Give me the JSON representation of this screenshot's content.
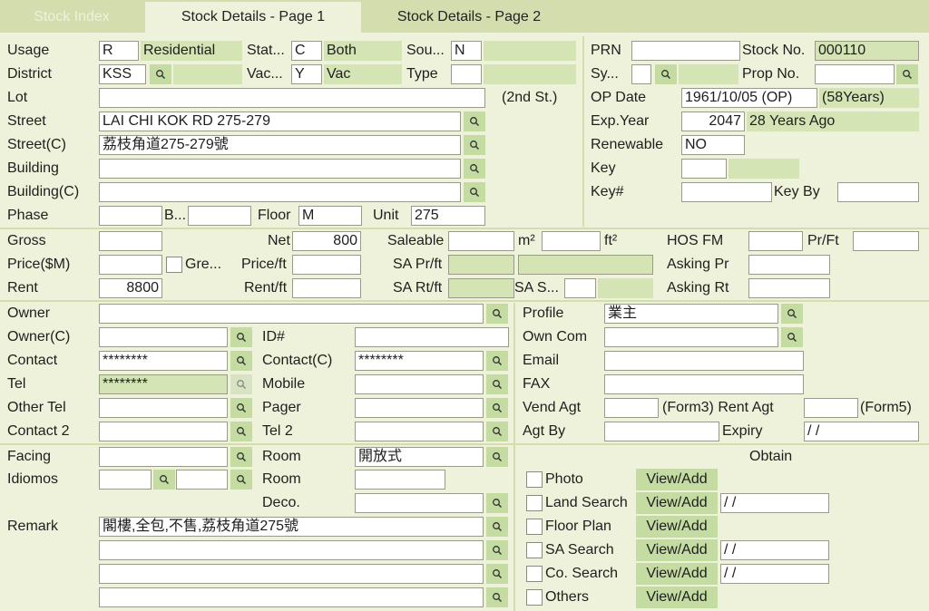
{
  "tabs": [
    "Stock Index",
    "Stock Details - Page 1",
    "Stock Details - Page 2"
  ],
  "labels": {
    "usage": "Usage",
    "district": "District",
    "lot": "Lot",
    "street": "Street",
    "street_c": "Street(C)",
    "building": "Building",
    "building_c": "Building(C)",
    "phase": "Phase",
    "block": "B...",
    "floor": "Floor",
    "unit": "Unit",
    "status": "Stat...",
    "vacant": "Vac...",
    "source": "Sou...",
    "type": "Type",
    "second_st": "(2nd St.)",
    "prn": "PRN",
    "stock_no": "Stock No.",
    "sy": "Sy...",
    "prop_no": "Prop No.",
    "op_date": "OP Date",
    "exp_year": "Exp.Year",
    "renewable": "Renewable",
    "key": "Key",
    "key_no": "Key#",
    "key_by": "Key By",
    "gross": "Gross",
    "net": "Net",
    "saleable": "Saleable",
    "m2": "m²",
    "ft2": "ft²",
    "hos_fm": "HOS FM",
    "pr_ft": "Pr/Ft",
    "price": "Price($M)",
    "gre": "Gre...",
    "price_ft": "Price/ft",
    "sa_pr_ft": "SA Pr/ft",
    "asking_pr": "Asking Pr",
    "rent": "Rent",
    "rent_ft": "Rent/ft",
    "sa_rt_ft": "SA Rt/ft",
    "sa_s": "SA S...",
    "asking_rt": "Asking Rt",
    "owner": "Owner",
    "owner_c": "Owner(C)",
    "id_no": "ID#",
    "contact": "Contact",
    "contact_c": "Contact(C)",
    "tel": "Tel",
    "mobile": "Mobile",
    "other_tel": "Other Tel",
    "pager": "Pager",
    "contact2": "Contact 2",
    "tel2": "Tel 2",
    "profile": "Profile",
    "own_com": "Own Com",
    "email": "Email",
    "fax": "FAX",
    "vend_agt": "Vend Agt",
    "form3_rent_agt": "(Form3) Rent Agt",
    "form5": "(Form5)",
    "agt_by": "Agt By",
    "expiry": "Expiry",
    "facing": "Facing",
    "idiomos": "Idiomos",
    "room": "Room",
    "room2": "Room",
    "deco": "Deco.",
    "remark": "Remark",
    "obtain": "Obtain"
  },
  "values": {
    "usage_code": "R",
    "usage_desc": "Residential",
    "status_code": "C",
    "status_desc": "Both",
    "source_code": "N",
    "district_code": "KSS",
    "vacant_code": "Y",
    "vacant_desc": "Vac",
    "type": "",
    "lot": "",
    "street": "LAI CHI KOK RD 275-279",
    "street_c": "荔枝角道275-279號",
    "building": "",
    "building_c": "",
    "phase": "",
    "block": "",
    "floor": "M",
    "unit": "275",
    "prn": "",
    "stock_no": "000110",
    "sy": "",
    "prop_no": "",
    "op_date": "1961/10/05 (OP)",
    "op_years": "(58Years)",
    "exp_year": "2047",
    "exp_years_ago": "28 Years Ago",
    "renewable": "NO",
    "key": "",
    "key_no": "",
    "key_by": "",
    "gross": "",
    "net": "800",
    "saleable": "",
    "m2": "",
    "hos_fm": "",
    "pr_ft": "",
    "price": "",
    "price_ft": "",
    "sa_pr_ft": "",
    "asking_pr": "",
    "rent": "8800",
    "rent_ft": "",
    "sa_rt_ft": "",
    "sa_s": "",
    "asking_rt": "",
    "owner": "",
    "owner_c": "",
    "id_no": "",
    "contact": "********",
    "contact_c": "********",
    "tel": "********",
    "mobile": "",
    "other_tel": "",
    "pager": "",
    "contact2": "",
    "tel2": "",
    "profile": "業主",
    "own_com": "",
    "email": "",
    "fax": "",
    "vend_agt": "",
    "rent_agt": "",
    "agt_by": "",
    "expiry": " / /",
    "facing": "",
    "idiomos_a": "",
    "idiomos_b": "",
    "room": "開放式",
    "room2": "",
    "deco": "",
    "remark1": "閣樓,全包,不售,荔枝角道275號",
    "remark2": "",
    "remark3": "",
    "remark4": ""
  },
  "obtain": [
    {
      "label": "Photo",
      "button": "View/Add",
      "date": ""
    },
    {
      "label": "Land Search",
      "button": "View/Add",
      "date": " / /"
    },
    {
      "label": "Floor Plan",
      "button": "View/Add",
      "date": ""
    },
    {
      "label": "SA Search",
      "button": "View/Add",
      "date": " / /"
    },
    {
      "label": "Co. Search",
      "button": "View/Add",
      "date": " / /"
    },
    {
      "label": "Others",
      "button": "View/Add",
      "date": ""
    }
  ],
  "icons": {
    "search": "magnifier-icon"
  },
  "colors": {
    "background": "#eff2da",
    "tab_bar": "#d3ddae",
    "field_green": "#d5e4b5",
    "button_green": "#c4dba1"
  }
}
